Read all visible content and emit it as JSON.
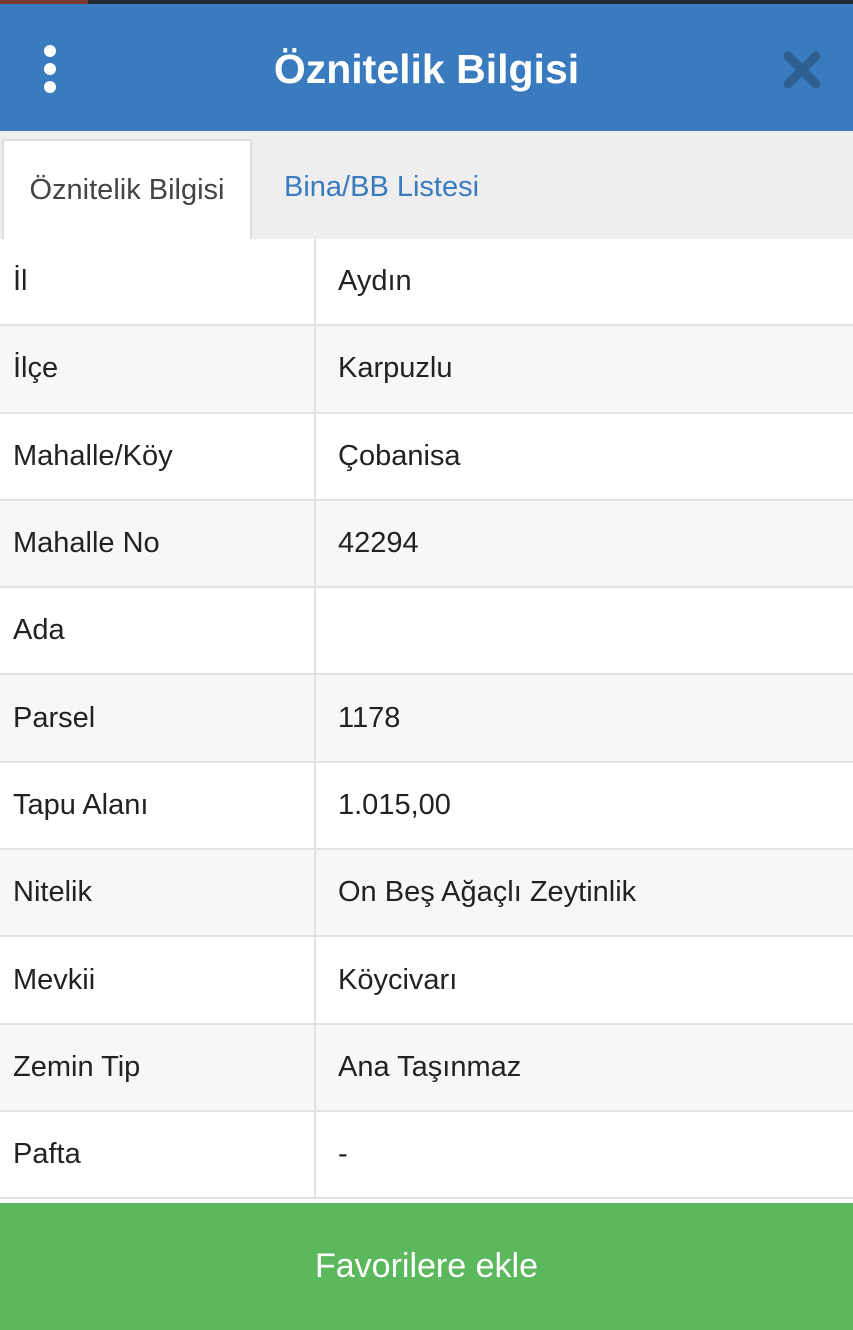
{
  "header": {
    "title": "Öznitelik Bilgisi",
    "menu_icon": "more-vertical-icon",
    "close_icon": "close-icon",
    "background_color": "#3a7bbf"
  },
  "tabs": [
    {
      "label": "Öznitelik Bilgisi",
      "active": true
    },
    {
      "label": "Bina/BB Listesi",
      "active": false
    }
  ],
  "attributes": [
    {
      "label": "İl",
      "value": "Aydın"
    },
    {
      "label": "İlçe",
      "value": "Karpuzlu"
    },
    {
      "label": "Mahalle/Köy",
      "value": "Çobanisa"
    },
    {
      "label": "Mahalle No",
      "value": "42294"
    },
    {
      "label": "Ada",
      "value": ""
    },
    {
      "label": "Parsel",
      "value": "1178"
    },
    {
      "label": "Tapu Alanı",
      "value": "1.015,00"
    },
    {
      "label": "Nitelik",
      "value": "On Beş Ağaçlı Zeytinlik"
    },
    {
      "label": "Mevkii",
      "value": "Köycivarı"
    },
    {
      "label": "Zemin Tip",
      "value": "Ana Taşınmaz"
    },
    {
      "label": "Pafta",
      "value": "-"
    }
  ],
  "footer": {
    "button_label": "Favorilere ekle",
    "button_color": "#5cb85c"
  }
}
